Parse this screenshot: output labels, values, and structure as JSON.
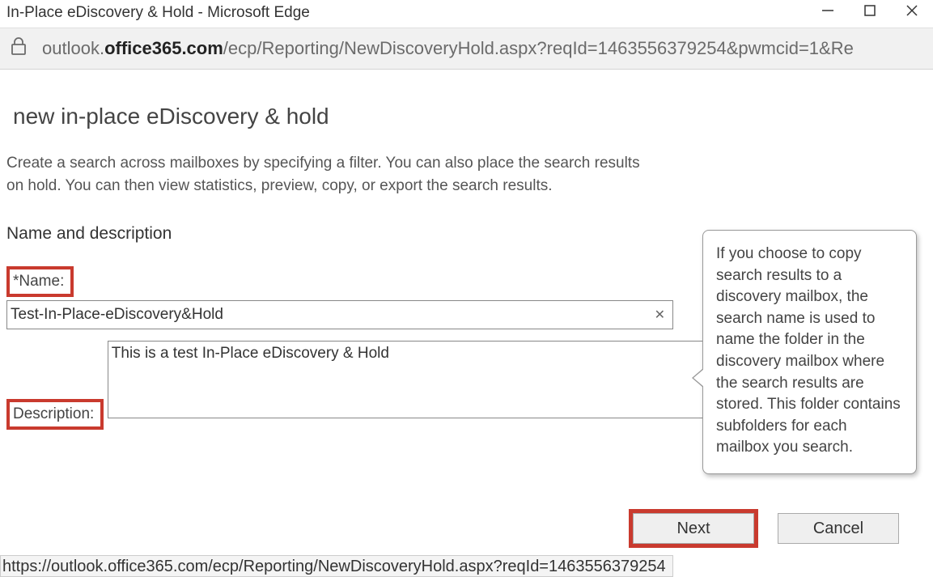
{
  "window": {
    "title": "In-Place eDiscovery & Hold - Microsoft Edge"
  },
  "address": {
    "prefix": "outlook.",
    "host": "office365.com",
    "path": "/ecp/Reporting/NewDiscoveryHold.aspx?reqId=1463556379254&pwmcid=1&Re"
  },
  "page": {
    "title": "new in-place eDiscovery & hold",
    "intro": "Create a search across mailboxes by specifying a filter. You can also place the search results on hold. You can then view statistics, preview, copy, or export the search results.",
    "section_heading": "Name and description",
    "name_label": "*Name:",
    "name_value": "Test-In-Place-eDiscovery&Hold",
    "description_label": "Description:",
    "description_value": "This is a test In-Place eDiscovery & Hold"
  },
  "tooltip": {
    "text": "If you choose to copy search results to a discovery mailbox, the search name is used to name the folder in the discovery mailbox where the search results are stored. This folder contains subfolders for each mailbox you search."
  },
  "buttons": {
    "next": "Next",
    "cancel": "Cancel"
  },
  "status": {
    "url": "https://outlook.office365.com/ecp/Reporting/NewDiscoveryHold.aspx?reqId=1463556379254"
  }
}
